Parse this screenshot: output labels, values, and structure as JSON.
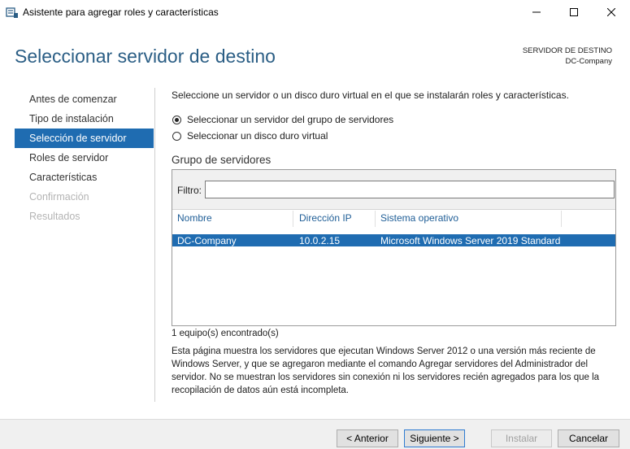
{
  "window": {
    "title": "Asistente para agregar roles y características"
  },
  "header": {
    "title": "Seleccionar servidor de destino",
    "dest_label": "SERVIDOR DE DESTINO",
    "dest_value": "DC-Company"
  },
  "nav": {
    "items": [
      {
        "label": "Antes de comenzar",
        "state": "normal"
      },
      {
        "label": "Tipo de instalación",
        "state": "normal"
      },
      {
        "label": "Selección de servidor",
        "state": "active"
      },
      {
        "label": "Roles de servidor",
        "state": "normal"
      },
      {
        "label": "Características",
        "state": "normal"
      },
      {
        "label": "Confirmación",
        "state": "disabled"
      },
      {
        "label": "Resultados",
        "state": "disabled"
      }
    ]
  },
  "content": {
    "intro": "Seleccione un servidor o un disco duro virtual en el que se instalarán roles y características.",
    "radio1": "Seleccionar un servidor del grupo de servidores",
    "radio2": "Seleccionar un disco duro virtual",
    "group_title": "Grupo de servidores",
    "filter_label": "Filtro:",
    "filter_value": "",
    "columns": [
      "Nombre",
      "Dirección IP",
      "Sistema operativo"
    ],
    "rows": [
      {
        "name": "DC-Company",
        "ip": "10.0.2.15",
        "os": "Microsoft Windows Server 2019 Standard"
      }
    ],
    "found": "1 equipo(s) encontrado(s)",
    "description": "Esta página muestra los servidores que ejecutan Windows Server 2012 o una versión más reciente de Windows Server, y que se agregaron mediante el comando Agregar servidores del Administrador del servidor. No se muestran los servidores sin conexión ni los servidores recién agregados para los que la recopilación de datos aún está incompleta."
  },
  "footer": {
    "back": "< Anterior",
    "next": "Siguiente >",
    "install": "Instalar",
    "cancel": "Cancelar"
  },
  "colors": {
    "accent": "#1f6cb1",
    "title": "#2b5e85"
  }
}
